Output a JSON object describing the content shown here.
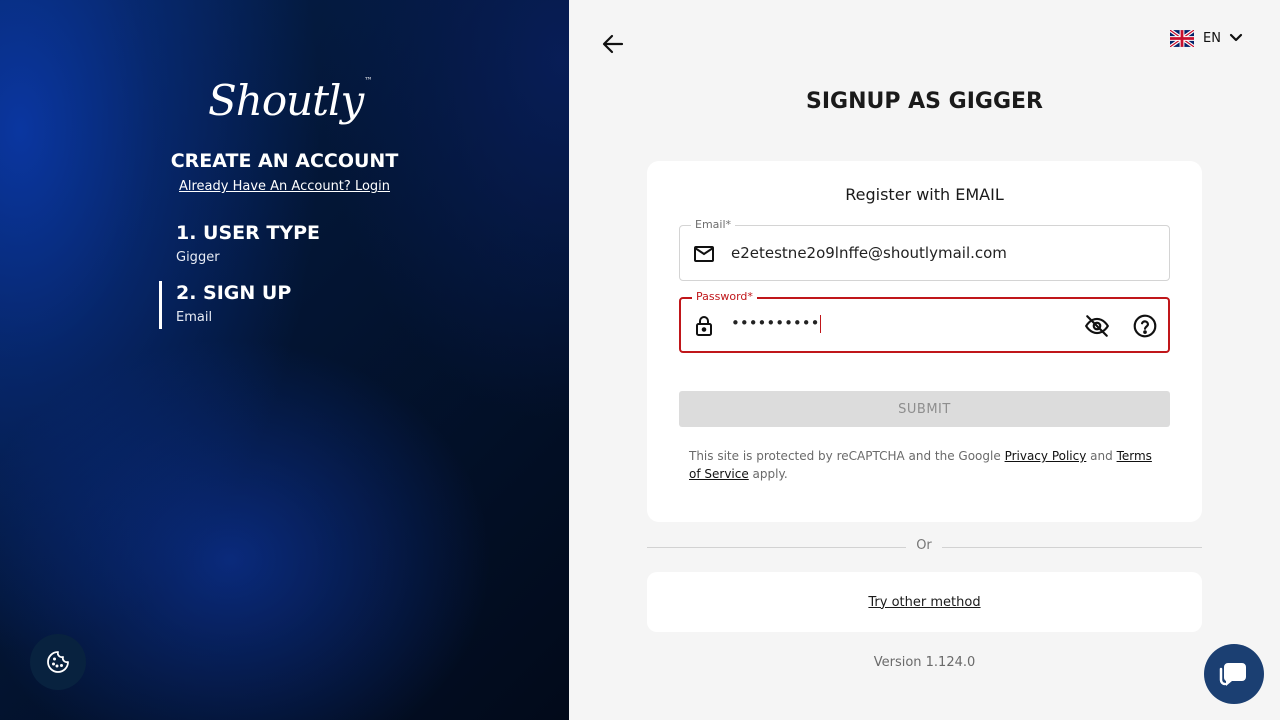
{
  "sidebar": {
    "logo_text": "Shoutly",
    "logo_tm": "™",
    "title": "CREATE AN ACCOUNT",
    "login_link": "Already Have An Account? Login",
    "steps": [
      {
        "title": "1. USER TYPE",
        "subtitle": "Gigger"
      },
      {
        "title": "2. SIGN UP",
        "subtitle": "Email"
      }
    ]
  },
  "header": {
    "language_code": "EN",
    "page_title": "SIGNUP AS GIGGER"
  },
  "form": {
    "subtitle": "Register with EMAIL",
    "email_label": "Email*",
    "email_value": "e2etestne2o9lnffe@shoutlymail.com",
    "password_label": "Password*",
    "password_value": "••••••••••",
    "submit_label": "SUBMIT",
    "legal_prefix": "This site is protected by reCAPTCHA and the Google ",
    "privacy_link": "Privacy Policy",
    "legal_and": " and ",
    "terms_link": "Terms of Service",
    "legal_suffix": " apply."
  },
  "divider_text": "Or",
  "alt_method_link": "Try other method",
  "version": "Version 1.124.0",
  "colors": {
    "error": "#c0161a",
    "sidebar_dark": "#031636",
    "chat_button": "#1b3f72"
  },
  "icons": [
    "arrow-back-icon",
    "uk-flag-icon",
    "chevron-down-icon",
    "mail-icon",
    "lock-icon",
    "eye-off-icon",
    "help-circle-icon",
    "cookie-icon",
    "chat-icon"
  ]
}
